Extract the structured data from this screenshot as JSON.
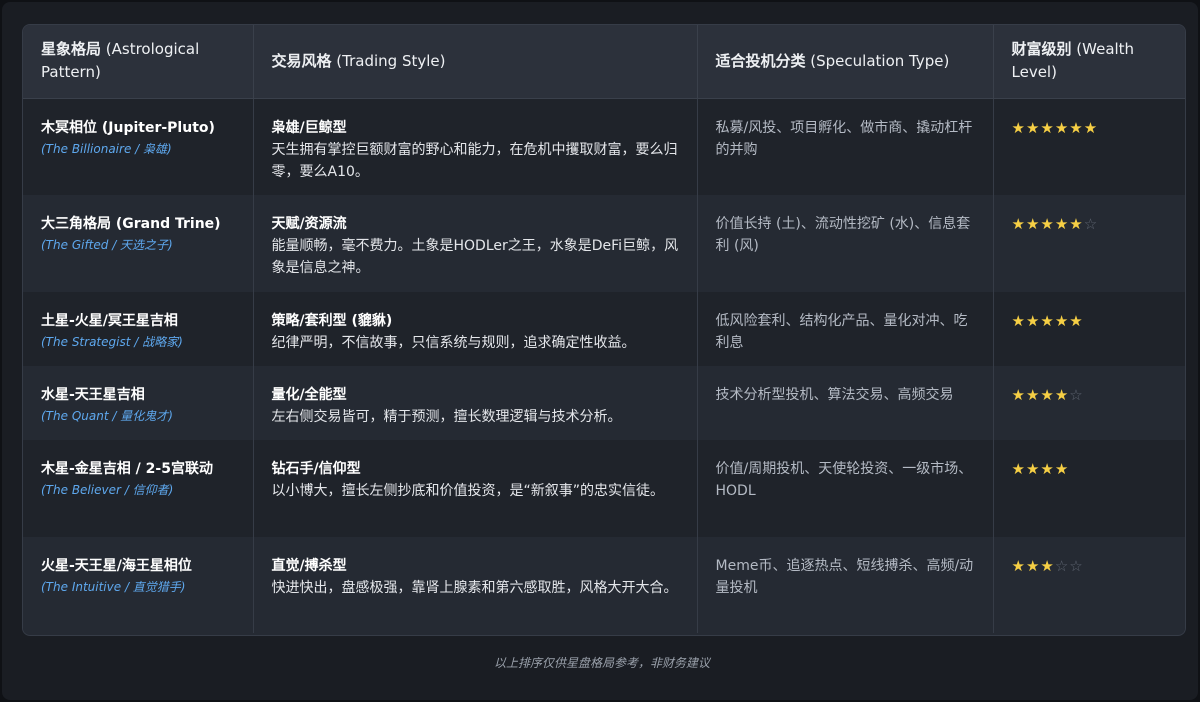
{
  "table": {
    "headers": [
      {
        "main": "星象格局",
        "sub": " (Astrological Pattern)"
      },
      {
        "main": "交易风格",
        "sub": " (Trading Style)"
      },
      {
        "main": "适合投机分类",
        "sub": " (Speculation Type)"
      },
      {
        "main": "财富级别",
        "sub": " (Wealth Level)"
      }
    ],
    "rows": [
      {
        "pattern": "木冥相位 (Jupiter-Pluto)",
        "pattern_sub": "(The Billionaire / 枭雄)",
        "style": "枭雄/巨鲸型",
        "style_desc": "天生拥有掌控巨额财富的野心和能力，在危机中攫取财富，要么归零，要么A10。",
        "speculation": "私募/风投、项目孵化、做市商、撬动杠杆的并购",
        "stars_filled": "★★★★★★",
        "stars_empty": ""
      },
      {
        "pattern": "大三角格局 (Grand Trine)",
        "pattern_sub": "(The Gifted / 天选之子)",
        "style": "天赋/资源流",
        "style_desc": "能量顺畅，毫不费力。土象是HODLer之王，水象是DeFi巨鲸，风象是信息之神。",
        "speculation": "价值长持 (土)、流动性挖矿 (水)、信息套利 (风)",
        "stars_filled": "★★★★★",
        "stars_empty": "☆"
      },
      {
        "pattern": "土星-火星/冥王星吉相",
        "pattern_sub": "(The Strategist / 战略家)",
        "style": "策略/套利型 (貔貅)",
        "style_desc": "纪律严明，不信故事，只信系统与规则，追求确定性收益。",
        "speculation": "低风险套利、结构化产品、量化对冲、吃利息",
        "stars_filled": "★★★★★",
        "stars_empty": ""
      },
      {
        "pattern": "水星-天王星吉相",
        "pattern_sub": "(The Quant / 量化鬼才)",
        "style": "量化/全能型",
        "style_desc": "左右侧交易皆可，精于预测，擅长数理逻辑与技术分析。",
        "speculation": "技术分析型投机、算法交易、高频交易",
        "stars_filled": "★★★★",
        "stars_empty": "☆"
      },
      {
        "pattern": "木星-金星吉相 / 2-5宫联动",
        "pattern_sub": "(The Believer / 信仰者)",
        "style": "钻石手/信仰型",
        "style_desc": "以小博大，擅长左侧抄底和价值投资，是“新叙事”的忠实信徒。",
        "speculation": "价值/周期投机、天使轮投资、一级市场、HODL",
        "stars_filled": "★★★★",
        "stars_empty": ""
      },
      {
        "pattern": "火星-天王星/海王星相位",
        "pattern_sub": "(The Intuitive / 直觉猎手)",
        "style": "直觉/搏杀型",
        "style_desc": "快进快出，盘感极强，靠肾上腺素和第六感取胜，风格大开大合。",
        "speculation": "Meme币、追逐热点、短线搏杀、高频/动量投机",
        "stars_filled": "★★★",
        "stars_empty": "☆☆"
      }
    ]
  },
  "footer": {
    "note": "以上排序仅供星盘格局参考，非财务建议"
  },
  "colors": {
    "star_on": "#f6cf45",
    "star_off": "#5d6470",
    "accent_italic": "#5ea8ee"
  }
}
